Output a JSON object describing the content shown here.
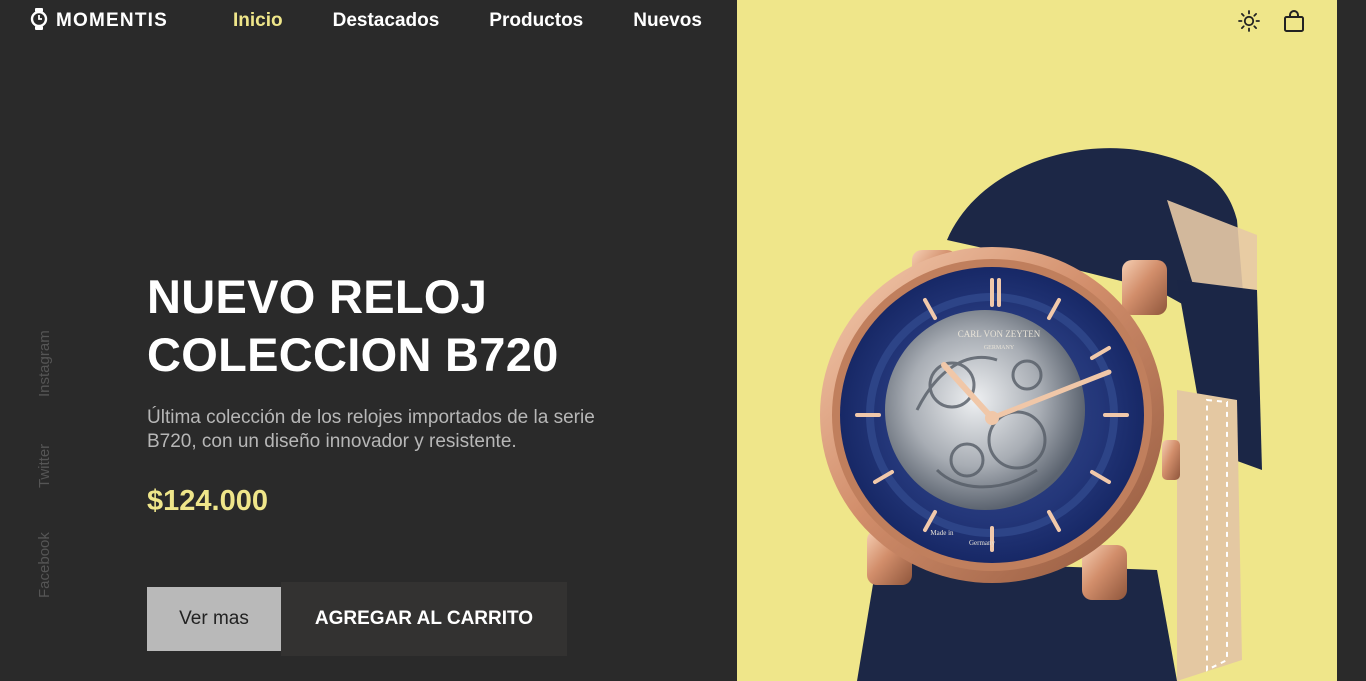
{
  "brand": {
    "name": "MOMENTIS",
    "icon": "watch-icon"
  },
  "nav": {
    "items": [
      {
        "label": "Inicio",
        "active": true
      },
      {
        "label": "Destacados",
        "active": false
      },
      {
        "label": "Productos",
        "active": false
      },
      {
        "label": "Nuevos",
        "active": false
      }
    ]
  },
  "header_icons": {
    "theme": "sun-icon",
    "cart": "shopping-bag-icon"
  },
  "social": {
    "instagram": "Instagram",
    "twitter": "Twitter",
    "facebook": "Facebook"
  },
  "hero": {
    "title_line1": "NUEVO RELOJ",
    "title_line2": "COLECCION B720",
    "description": "Última colección de los relojes importados de la serie B720, con un diseño innovador y resistente.",
    "price": "$124.000",
    "more_button": "Ver mas",
    "cart_button": "AGREGAR AL CARRITO"
  },
  "watch": {
    "brand_text": "CARL VON ZEYTEN",
    "country_text": "GERMANY",
    "made_text": "Made in",
    "made_country": "Germany"
  },
  "colors": {
    "background": "#2a2a2a",
    "accent": "#efe68a",
    "panel": "#efe68a",
    "muted_text": "#b7b7b7",
    "button_light": "#b9b9b9",
    "button_dark": "#333231"
  }
}
